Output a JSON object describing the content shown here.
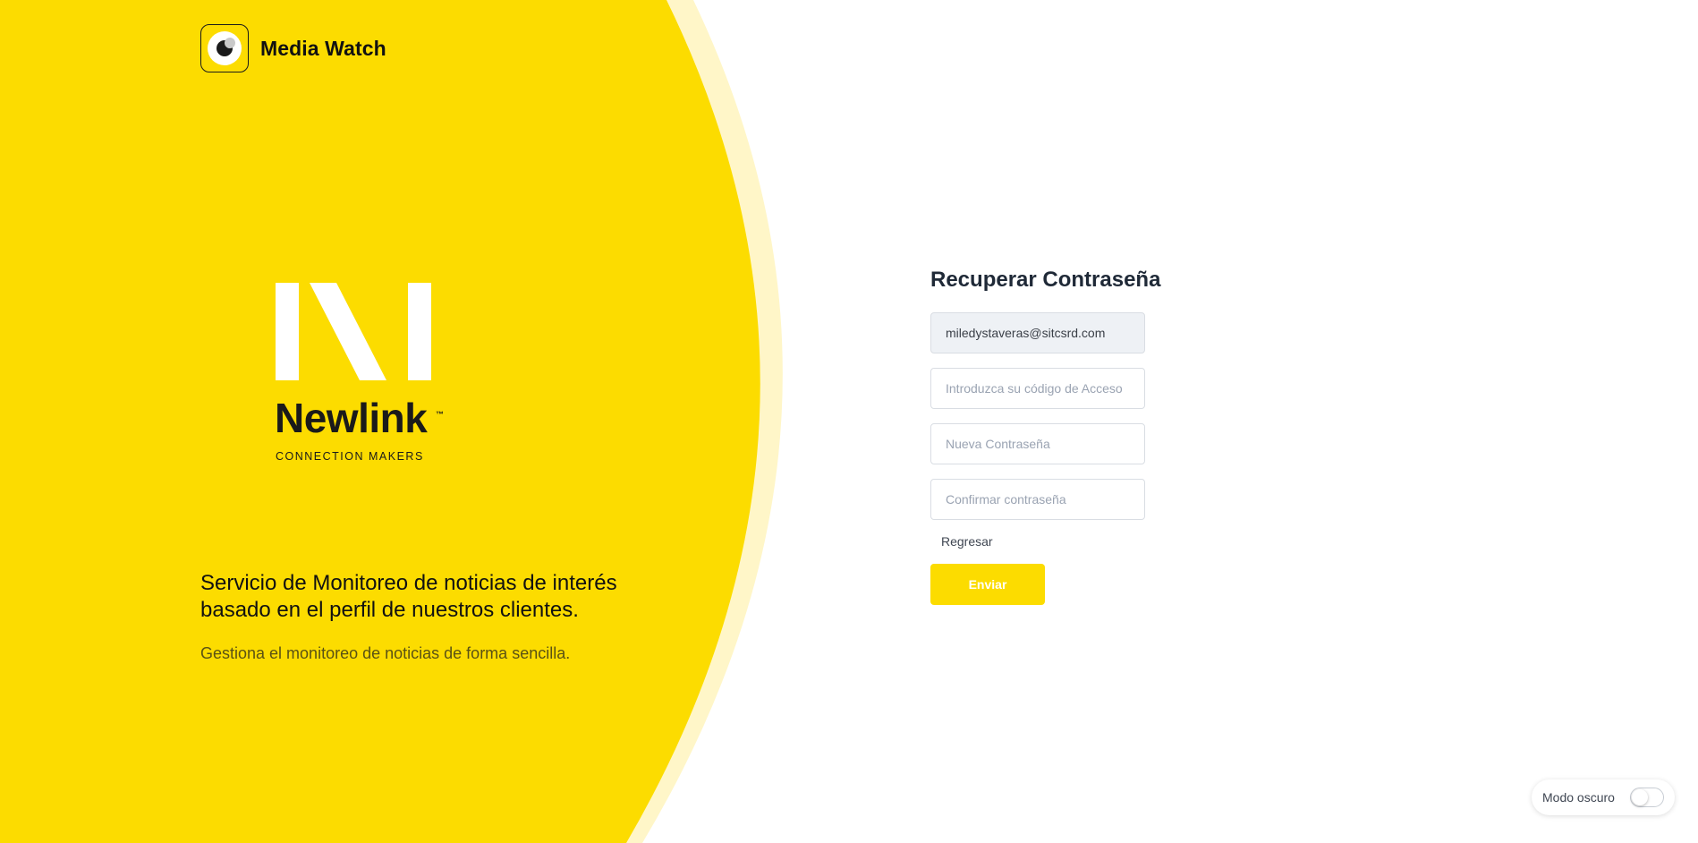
{
  "brand": {
    "name": "Media Watch",
    "logo_icon": "eye-icon"
  },
  "newlink": {
    "wordmark": "Newlink",
    "trademark": "™",
    "tagline": "CONNECTION MAKERS"
  },
  "hero": {
    "title": "Servicio de Monitoreo de noticias de interés basado en el perfil de nuestros clientes.",
    "subtitle": "Gestiona el monitoreo de noticias de forma sencilla."
  },
  "form": {
    "title": "Recuperar Contraseña",
    "email": {
      "value": "miledystaveras@sitcsrd.com"
    },
    "code": {
      "placeholder": "Introduzca su código de Acceso"
    },
    "new_password": {
      "placeholder": "Nueva Contraseña"
    },
    "confirm_password": {
      "placeholder": "Confirmar contraseña"
    },
    "back_label": "Regresar",
    "submit_label": "Enviar"
  },
  "dark_mode": {
    "label": "Modo oscuro",
    "enabled": false
  },
  "colors": {
    "brand_yellow": "#FCDC00",
    "pale_yellow": "#FFF6C8",
    "text_dark": "#1f2937"
  }
}
